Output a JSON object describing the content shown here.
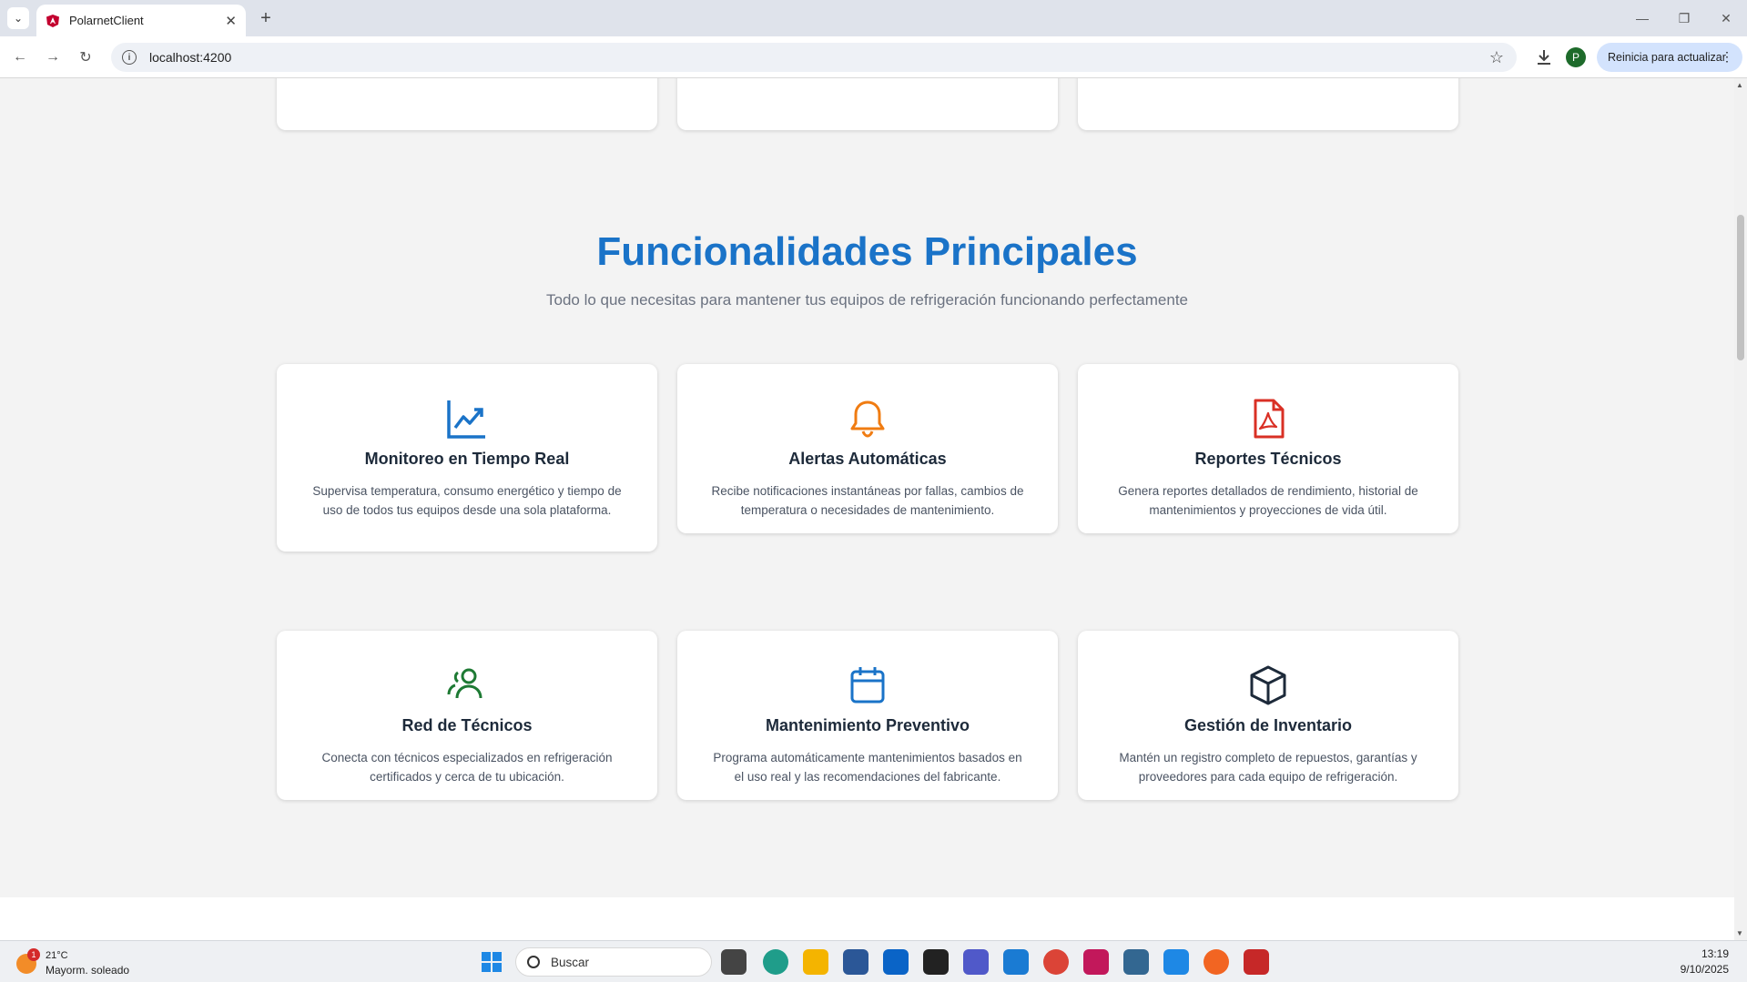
{
  "browser": {
    "tab_title": "PolarnetClient",
    "url": "localhost:4200",
    "update_label": "Reinicia para actualizar",
    "profile_initial": "P"
  },
  "section": {
    "title": "Funcionalidades Principales",
    "subtitle": "Todo lo que necesitas para mantener tus equipos de refrigeración funcionando perfectamente"
  },
  "features": [
    {
      "title": "Monitoreo en Tiempo Real",
      "description": "Supervisa temperatura, consumo energético y tiempo de uso de todos tus equipos desde una sola plataforma.",
      "icon": "chart-line-icon",
      "color": "#1a73c8"
    },
    {
      "title": "Alertas Automáticas",
      "description": "Recibe notificaciones instantáneas por fallas, cambios de temperatura o necesidades de mantenimiento.",
      "icon": "bell-icon",
      "color": "#f07c12"
    },
    {
      "title": "Reportes Técnicos",
      "description": "Genera reportes detallados de rendimiento, historial de mantenimientos y proyecciones de vida útil.",
      "icon": "pdf-file-icon",
      "color": "#d93025"
    },
    {
      "title": "Red de Técnicos",
      "description": "Conecta con técnicos especializados en refrigeración certificados y cerca de tu ubicación.",
      "icon": "users-icon",
      "color": "#1e7a34"
    },
    {
      "title": "Mantenimiento Preventivo",
      "description": "Programa automáticamente mantenimientos basados en el uso real y las recomendaciones del fabricante.",
      "icon": "calendar-icon",
      "color": "#1a73c8"
    },
    {
      "title": "Gestión de Inventario",
      "description": "Mantén un registro completo de repuestos, garantías y proveedores para cada equipo de refrigeración.",
      "icon": "box-icon",
      "color": "#1d2a3a"
    }
  ],
  "taskbar": {
    "weather_badge": "1",
    "temperature": "21°C",
    "weather_condition": "Mayorm. soleado",
    "search_placeholder": "Buscar",
    "time": "13:19",
    "date": "9/10/2025"
  }
}
